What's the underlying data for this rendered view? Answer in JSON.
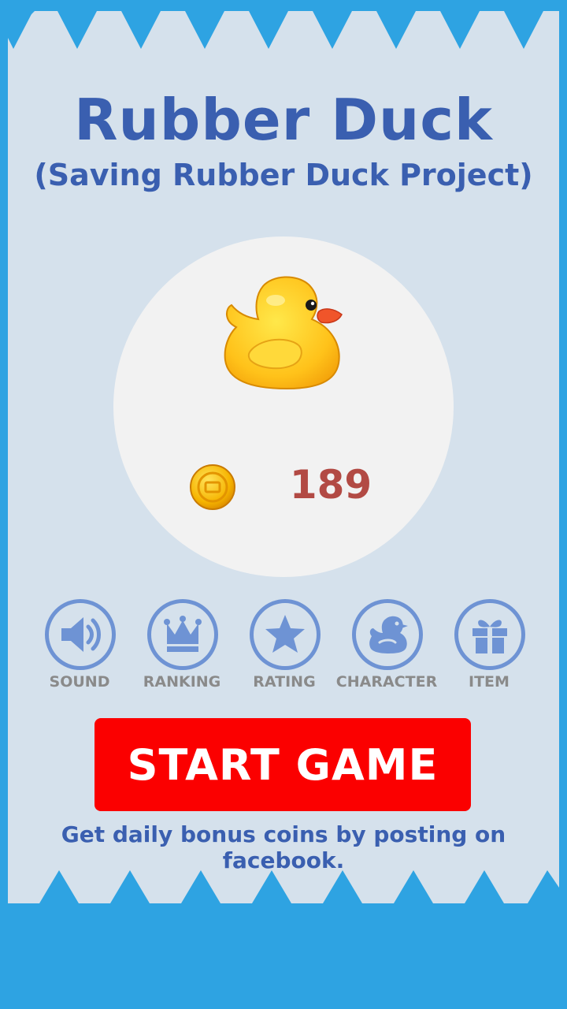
{
  "header": {
    "title": "Rubber Duck",
    "subtitle": "(Saving Rubber Duck Project)"
  },
  "wallet": {
    "coins": "189"
  },
  "menu": [
    {
      "label": "SOUND",
      "icon": "speaker-icon"
    },
    {
      "label": "RANKING",
      "icon": "crown-icon"
    },
    {
      "label": "RATING",
      "icon": "star-icon"
    },
    {
      "label": "CHARACTER",
      "icon": "duck-icon"
    },
    {
      "label": "ITEM",
      "icon": "gift-icon"
    }
  ],
  "actions": {
    "start_label": "START GAME"
  },
  "footer": {
    "hint": "Get daily bonus coins by posting on facebook."
  },
  "colors": {
    "background": "#2ea3e2",
    "card": "#d5e1ec",
    "title": "#3a5fb0",
    "icon_ring": "#6e93d4",
    "start_button": "#fb0000",
    "coin_value": "#b24a44"
  }
}
